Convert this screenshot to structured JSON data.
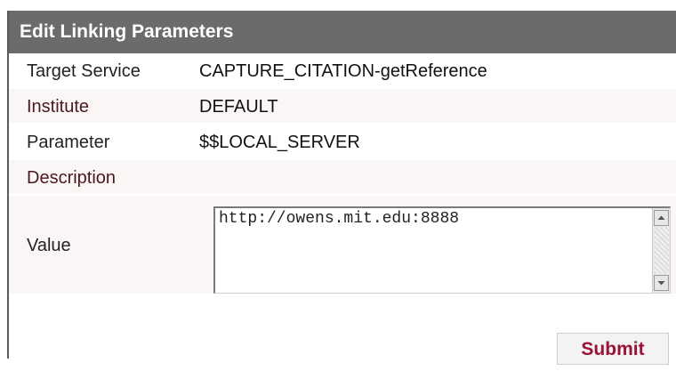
{
  "panel": {
    "title": "Edit Linking Parameters"
  },
  "fields": {
    "target_service": {
      "label": "Target Service",
      "value": "CAPTURE_CITATION-getReference"
    },
    "institute": {
      "label": "Institute",
      "value": "DEFAULT"
    },
    "parameter": {
      "label": "Parameter",
      "value": "$$LOCAL_SERVER"
    },
    "description": {
      "label": "Description",
      "value": ""
    },
    "value": {
      "label": "Value",
      "text": "http://owens.mit.edu:8888"
    }
  },
  "actions": {
    "submit_label": "Submit"
  },
  "colors": {
    "header_bg": "#6b6b6b",
    "submit_text": "#9b1236",
    "row_tint": "#fbf6f6"
  },
  "icons": {
    "scroll_up": "chevron-up-icon",
    "scroll_down": "chevron-down-icon"
  }
}
